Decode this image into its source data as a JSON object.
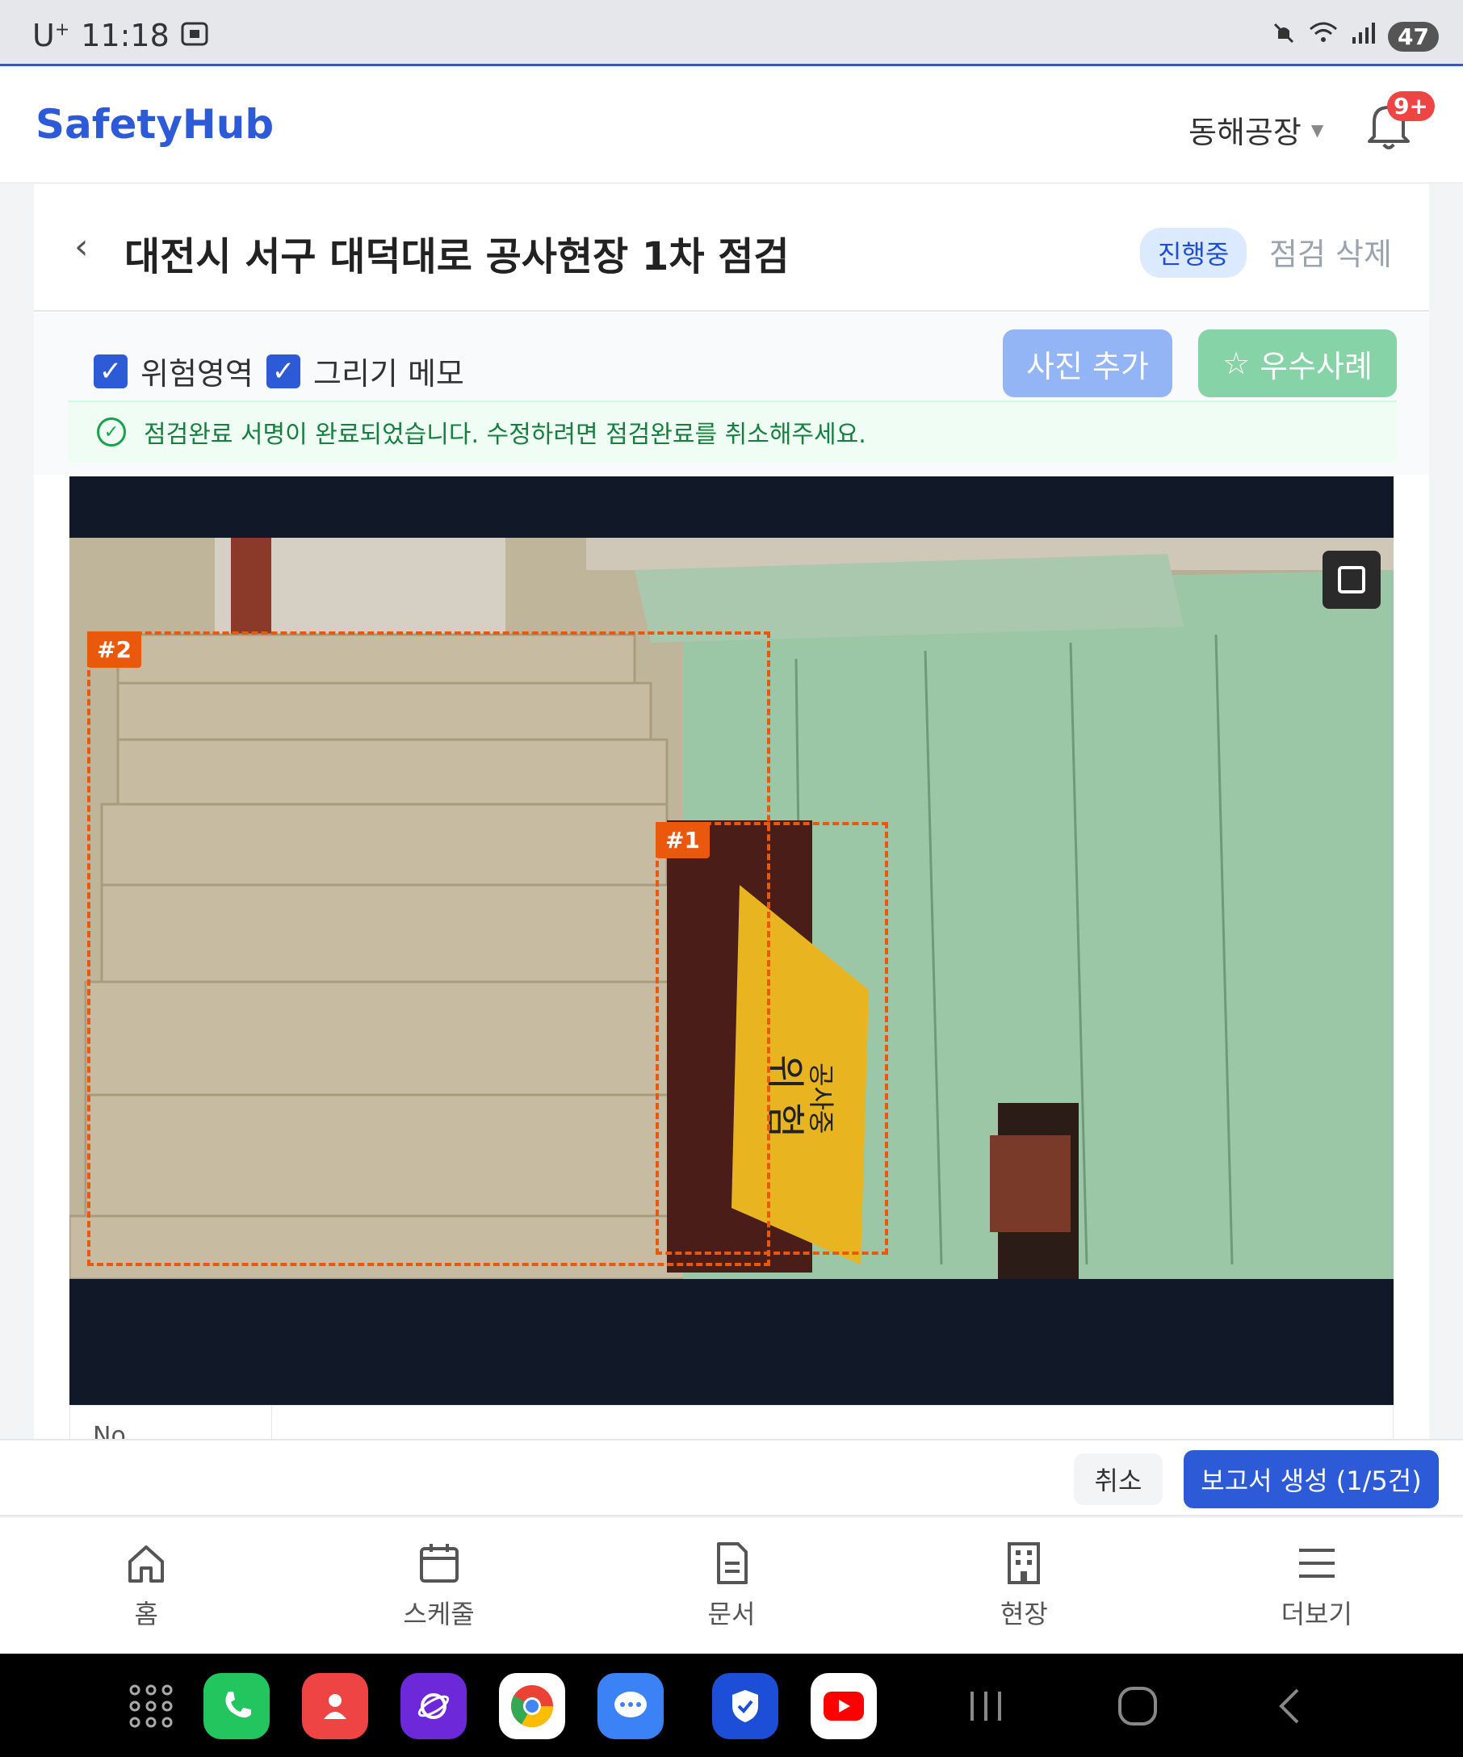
{
  "status_bar": {
    "carrier": "U",
    "carrier_sup": "+",
    "time": "11:18",
    "battery": "47"
  },
  "header": {
    "logo": "SafetyHub",
    "site": "동해공장",
    "notification_badge": "9+"
  },
  "page": {
    "back": "‹",
    "title": "대전시 서구 대덕대로 공사현장 1차 점검",
    "status": "진행중",
    "delete": "점검 삭제"
  },
  "toolbar": {
    "hazard_checkbox": "위험영역",
    "memo_checkbox": "그리기 메모",
    "add_photo": "사진 추가",
    "best_practice": "우수사례",
    "notice": "점검완료 서명이 완료되었습니다. 수정하려면 점검완료를 취소해주세요."
  },
  "photo": {
    "regions": [
      {
        "label": "#2"
      },
      {
        "label": "#1"
      }
    ],
    "sign_text_1": "위 험",
    "sign_text_2": "공사중"
  },
  "table_peek": {
    "col_no": "No."
  },
  "report_bar": {
    "cancel": "취소",
    "generate": "보고서 생성 (1/5건)"
  },
  "bottom_nav": {
    "home": "홈",
    "schedule": "스케줄",
    "documents": "문서",
    "site": "현장",
    "more": "더보기"
  },
  "colors": {
    "accent": "#2d5bd7",
    "hazard": "#ea580c",
    "success": "#15803d"
  }
}
